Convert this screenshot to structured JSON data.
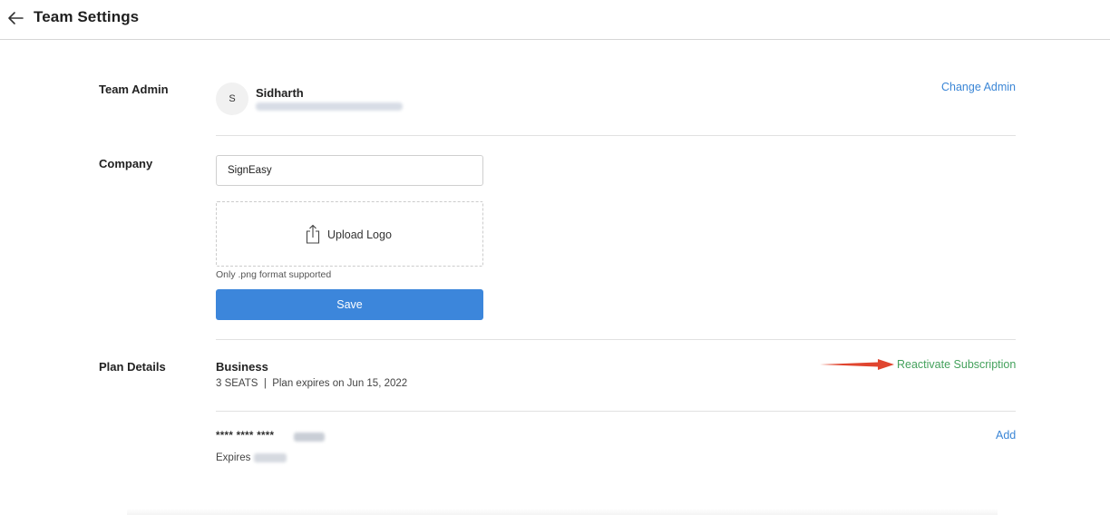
{
  "header": {
    "title": "Team Settings",
    "back_icon": "arrow-left-icon"
  },
  "team_admin": {
    "label": "Team Admin",
    "avatar_initial": "S",
    "name": "Sidharth",
    "change_label": "Change Admin"
  },
  "company": {
    "label": "Company",
    "name_value": "SignEasy",
    "upload_label": "Upload Logo",
    "upload_icon": "share-upload-icon",
    "upload_hint": "Only .png format supported",
    "save_label": "Save"
  },
  "plan": {
    "label": "Plan Details",
    "name": "Business",
    "meta": "3 SEATS  |  Plan expires on Jun 15, 2022",
    "reactivate_label": "Reactivate Subscription",
    "card_mask": "**** **** ****",
    "expires_label": "Expires",
    "add_label": "Add"
  },
  "colors": {
    "link_blue": "#3b86d6",
    "save_blue": "#3c86db",
    "reactivate_green": "#44a15c",
    "annotation_red": "#e0452f"
  }
}
